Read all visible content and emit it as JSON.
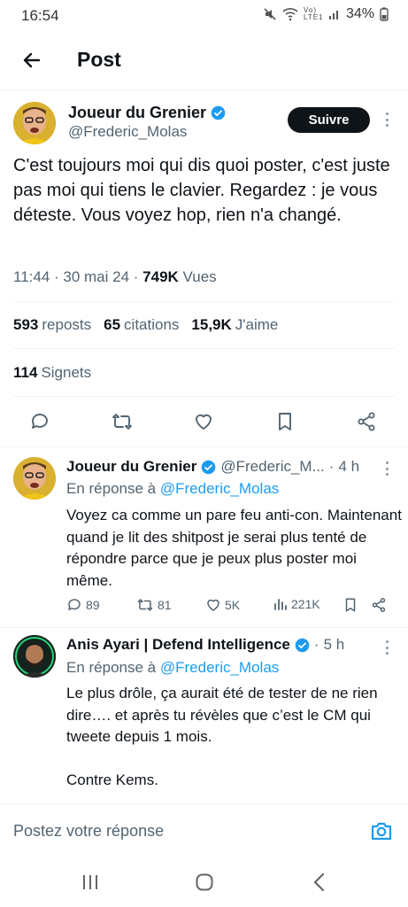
{
  "status_bar": {
    "time": "16:54",
    "network_label": "Vo) LTE1",
    "battery": "34%"
  },
  "header": {
    "title": "Post"
  },
  "post": {
    "author_name": "Joueur du Grenier",
    "author_handle": "@Frederic_Molas",
    "follow_label": "Suivre",
    "text": "C'est toujours moi qui dis quoi poster, c'est juste pas moi qui tiens le clavier. Regardez : je vous déteste. Vous voyez hop, rien n'a changé.",
    "time": "11:44",
    "date": "30 mai 24",
    "views_count": "749K",
    "views_label": "Vues",
    "reposts_count": "593",
    "reposts_label": "reposts",
    "quotes_count": "65",
    "quotes_label": "citations",
    "likes_count": "15,9K",
    "likes_label": "J'aime",
    "bookmarks_count": "114",
    "bookmarks_label": "Signets"
  },
  "replies": [
    {
      "author_name": "Joueur du Grenier",
      "author_handle": "@Frederic_M...",
      "time": "4 h",
      "replying_prefix": "En réponse à",
      "replying_to": "@Frederic_Molas",
      "text": "Voyez ca comme un pare feu anti-con. Maintenant quand je lit des shitpost je serai plus tenté de répondre parce que je peux plus poster moi même.",
      "replies": "89",
      "reposts": "81",
      "likes": "5K",
      "views": "221K"
    },
    {
      "author_name": "Anis Ayari | Defend Intelligence",
      "time": "5 h",
      "replying_prefix": "En réponse à",
      "replying_to": "@Frederic_Molas",
      "text": "Le plus drôle, ça aurait été de tester de ne rien dire…. et après tu révèles que c’est le CM qui tweete depuis 1 mois.\n\nContre Kems."
    }
  ],
  "compose": {
    "placeholder": "Postez votre réponse"
  },
  "colors": {
    "accent": "#1d9bf0",
    "text": "#0f1419",
    "secondary": "#536471"
  }
}
